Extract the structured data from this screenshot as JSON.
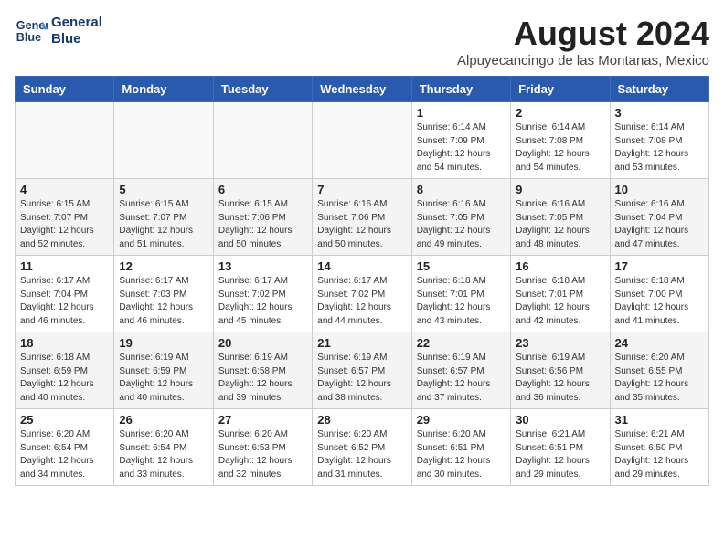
{
  "header": {
    "logo_line1": "General",
    "logo_line2": "Blue",
    "month": "August 2024",
    "location": "Alpuyecancingo de las Montanas, Mexico"
  },
  "weekdays": [
    "Sunday",
    "Monday",
    "Tuesday",
    "Wednesday",
    "Thursday",
    "Friday",
    "Saturday"
  ],
  "weeks": [
    [
      {
        "day": "",
        "info": ""
      },
      {
        "day": "",
        "info": ""
      },
      {
        "day": "",
        "info": ""
      },
      {
        "day": "",
        "info": ""
      },
      {
        "day": "1",
        "info": "Sunrise: 6:14 AM\nSunset: 7:09 PM\nDaylight: 12 hours\nand 54 minutes."
      },
      {
        "day": "2",
        "info": "Sunrise: 6:14 AM\nSunset: 7:08 PM\nDaylight: 12 hours\nand 54 minutes."
      },
      {
        "day": "3",
        "info": "Sunrise: 6:14 AM\nSunset: 7:08 PM\nDaylight: 12 hours\nand 53 minutes."
      }
    ],
    [
      {
        "day": "4",
        "info": "Sunrise: 6:15 AM\nSunset: 7:07 PM\nDaylight: 12 hours\nand 52 minutes."
      },
      {
        "day": "5",
        "info": "Sunrise: 6:15 AM\nSunset: 7:07 PM\nDaylight: 12 hours\nand 51 minutes."
      },
      {
        "day": "6",
        "info": "Sunrise: 6:15 AM\nSunset: 7:06 PM\nDaylight: 12 hours\nand 50 minutes."
      },
      {
        "day": "7",
        "info": "Sunrise: 6:16 AM\nSunset: 7:06 PM\nDaylight: 12 hours\nand 50 minutes."
      },
      {
        "day": "8",
        "info": "Sunrise: 6:16 AM\nSunset: 7:05 PM\nDaylight: 12 hours\nand 49 minutes."
      },
      {
        "day": "9",
        "info": "Sunrise: 6:16 AM\nSunset: 7:05 PM\nDaylight: 12 hours\nand 48 minutes."
      },
      {
        "day": "10",
        "info": "Sunrise: 6:16 AM\nSunset: 7:04 PM\nDaylight: 12 hours\nand 47 minutes."
      }
    ],
    [
      {
        "day": "11",
        "info": "Sunrise: 6:17 AM\nSunset: 7:04 PM\nDaylight: 12 hours\nand 46 minutes."
      },
      {
        "day": "12",
        "info": "Sunrise: 6:17 AM\nSunset: 7:03 PM\nDaylight: 12 hours\nand 46 minutes."
      },
      {
        "day": "13",
        "info": "Sunrise: 6:17 AM\nSunset: 7:02 PM\nDaylight: 12 hours\nand 45 minutes."
      },
      {
        "day": "14",
        "info": "Sunrise: 6:17 AM\nSunset: 7:02 PM\nDaylight: 12 hours\nand 44 minutes."
      },
      {
        "day": "15",
        "info": "Sunrise: 6:18 AM\nSunset: 7:01 PM\nDaylight: 12 hours\nand 43 minutes."
      },
      {
        "day": "16",
        "info": "Sunrise: 6:18 AM\nSunset: 7:01 PM\nDaylight: 12 hours\nand 42 minutes."
      },
      {
        "day": "17",
        "info": "Sunrise: 6:18 AM\nSunset: 7:00 PM\nDaylight: 12 hours\nand 41 minutes."
      }
    ],
    [
      {
        "day": "18",
        "info": "Sunrise: 6:18 AM\nSunset: 6:59 PM\nDaylight: 12 hours\nand 40 minutes."
      },
      {
        "day": "19",
        "info": "Sunrise: 6:19 AM\nSunset: 6:59 PM\nDaylight: 12 hours\nand 40 minutes."
      },
      {
        "day": "20",
        "info": "Sunrise: 6:19 AM\nSunset: 6:58 PM\nDaylight: 12 hours\nand 39 minutes."
      },
      {
        "day": "21",
        "info": "Sunrise: 6:19 AM\nSunset: 6:57 PM\nDaylight: 12 hours\nand 38 minutes."
      },
      {
        "day": "22",
        "info": "Sunrise: 6:19 AM\nSunset: 6:57 PM\nDaylight: 12 hours\nand 37 minutes."
      },
      {
        "day": "23",
        "info": "Sunrise: 6:19 AM\nSunset: 6:56 PM\nDaylight: 12 hours\nand 36 minutes."
      },
      {
        "day": "24",
        "info": "Sunrise: 6:20 AM\nSunset: 6:55 PM\nDaylight: 12 hours\nand 35 minutes."
      }
    ],
    [
      {
        "day": "25",
        "info": "Sunrise: 6:20 AM\nSunset: 6:54 PM\nDaylight: 12 hours\nand 34 minutes."
      },
      {
        "day": "26",
        "info": "Sunrise: 6:20 AM\nSunset: 6:54 PM\nDaylight: 12 hours\nand 33 minutes."
      },
      {
        "day": "27",
        "info": "Sunrise: 6:20 AM\nSunset: 6:53 PM\nDaylight: 12 hours\nand 32 minutes."
      },
      {
        "day": "28",
        "info": "Sunrise: 6:20 AM\nSunset: 6:52 PM\nDaylight: 12 hours\nand 31 minutes."
      },
      {
        "day": "29",
        "info": "Sunrise: 6:20 AM\nSunset: 6:51 PM\nDaylight: 12 hours\nand 30 minutes."
      },
      {
        "day": "30",
        "info": "Sunrise: 6:21 AM\nSunset: 6:51 PM\nDaylight: 12 hours\nand 29 minutes."
      },
      {
        "day": "31",
        "info": "Sunrise: 6:21 AM\nSunset: 6:50 PM\nDaylight: 12 hours\nand 29 minutes."
      }
    ]
  ]
}
